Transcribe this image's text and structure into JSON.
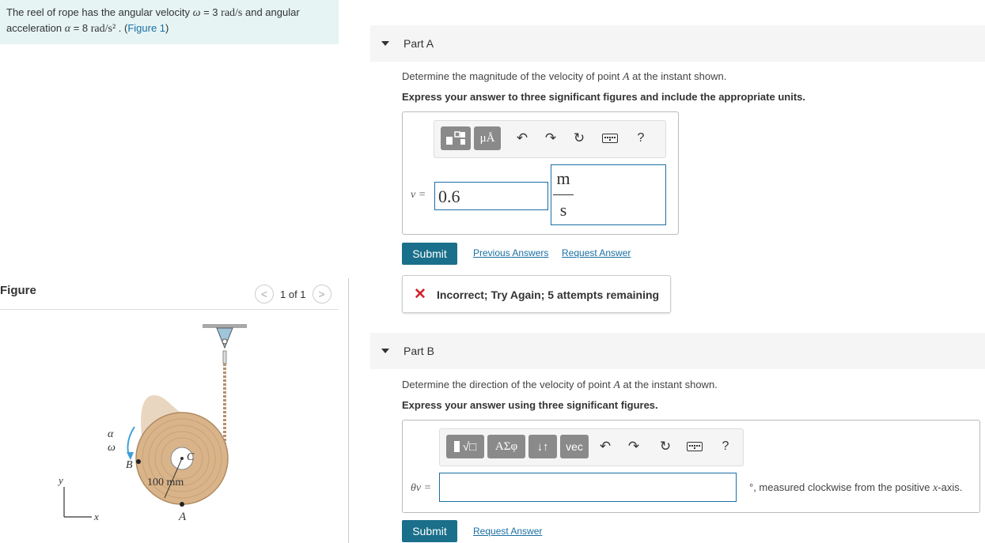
{
  "problem": {
    "text_1": "The reel of rope has the angular velocity ",
    "omega_sym": "ω",
    "omega_val": " = 3 ",
    "omega_unit": "rad/s",
    "text_2": " and angular acceleration ",
    "alpha_sym": "α",
    "alpha_val": " = 8 ",
    "alpha_unit": "rad/s²",
    "text_3": " . (",
    "figure_link": "Figure 1",
    "text_4": ")"
  },
  "figure": {
    "title": "Figure",
    "pager": "1 of 1",
    "labels": {
      "alpha": "α",
      "omega": "ω",
      "B": "B",
      "C": "C",
      "A": "A",
      "dim": "100 mm",
      "y": "y",
      "x": "x"
    }
  },
  "part_a": {
    "label": "Part A",
    "question_1": "Determine the magnitude of the velocity of point ",
    "question_point": "A",
    "question_2": " at the instant shown.",
    "instruction": "Express your answer to three significant figures and include the appropriate units.",
    "toolbar": {
      "mu_a": "μÅ",
      "help": "?"
    },
    "var_label": "v =",
    "value": "0.6",
    "unit_num": "m",
    "unit_den": "s",
    "submit": "Submit",
    "prev_answers": "Previous Answers",
    "request_answer": "Request Answer",
    "feedback": "Incorrect; Try Again; 5 attempts remaining"
  },
  "part_b": {
    "label": "Part B",
    "question_1": "Determine the direction of the velocity of point ",
    "question_point": "A",
    "question_2": " at the instant shown.",
    "instruction": "Express your answer using three significant figures.",
    "toolbar": {
      "sqrt": "√□",
      "greek": "ΑΣφ",
      "arrows": "↓↑",
      "vec": "vec",
      "help": "?"
    },
    "var_label": "θv =",
    "value": "",
    "suffix": "°, measured clockwise from the positive ",
    "suffix_axis": "x",
    "suffix_end": "-axis.",
    "submit": "Submit",
    "request_answer": "Request Answer"
  },
  "colors": {
    "accent": "#1a6fa3",
    "submit_bg": "#1a6f8a",
    "error": "#d0212b",
    "problem_bg": "#e6f4f4"
  }
}
